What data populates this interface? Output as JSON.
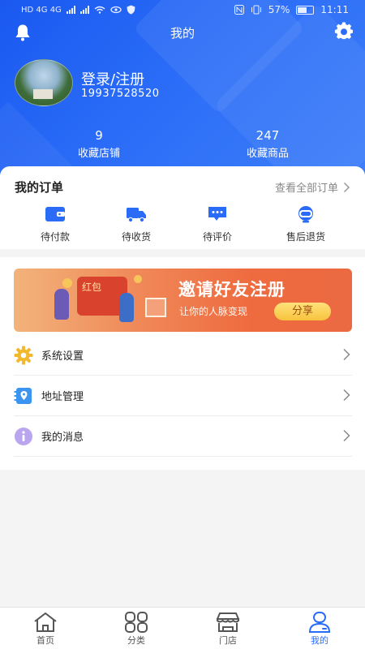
{
  "status_bar": {
    "network_left": "HD 4G 4G",
    "battery": "57%",
    "time": "11:11"
  },
  "header": {
    "title": "我的",
    "login_label": "登录/注册",
    "phone": "19937528520",
    "stats": [
      {
        "value": "9",
        "label": "收藏店铺"
      },
      {
        "value": "247",
        "label": "收藏商品"
      }
    ]
  },
  "orders": {
    "title": "我的订单",
    "view_all": "查看全部订单",
    "items": [
      {
        "label": "待付款",
        "icon": "wallet-icon"
      },
      {
        "label": "待收货",
        "icon": "truck-icon"
      },
      {
        "label": "待评价",
        "icon": "comment-icon"
      },
      {
        "label": "售后退货",
        "icon": "headset-icon"
      }
    ]
  },
  "banner": {
    "bag_text": "红包",
    "title": "邀请好友注册",
    "subtitle": "让你的人脉变现",
    "button": "分享"
  },
  "menu": [
    {
      "label": "系统设置",
      "icon": "settings-gear-icon"
    },
    {
      "label": "地址管理",
      "icon": "address-icon"
    },
    {
      "label": "我的消息",
      "icon": "info-icon"
    }
  ],
  "tabbar": [
    {
      "label": "首页",
      "icon": "home-icon",
      "active": false
    },
    {
      "label": "分类",
      "icon": "category-icon",
      "active": false
    },
    {
      "label": "门店",
      "icon": "store-icon",
      "active": false
    },
    {
      "label": "我的",
      "icon": "profile-icon",
      "active": true
    }
  ],
  "colors": {
    "primary": "#2a6cf7",
    "header_gradient_start": "#1a58f0",
    "banner_orange": "#ee6b3f",
    "settings_icon": "#f2b82e",
    "address_icon": "#3b95f0",
    "info_icon": "#a890e6"
  }
}
